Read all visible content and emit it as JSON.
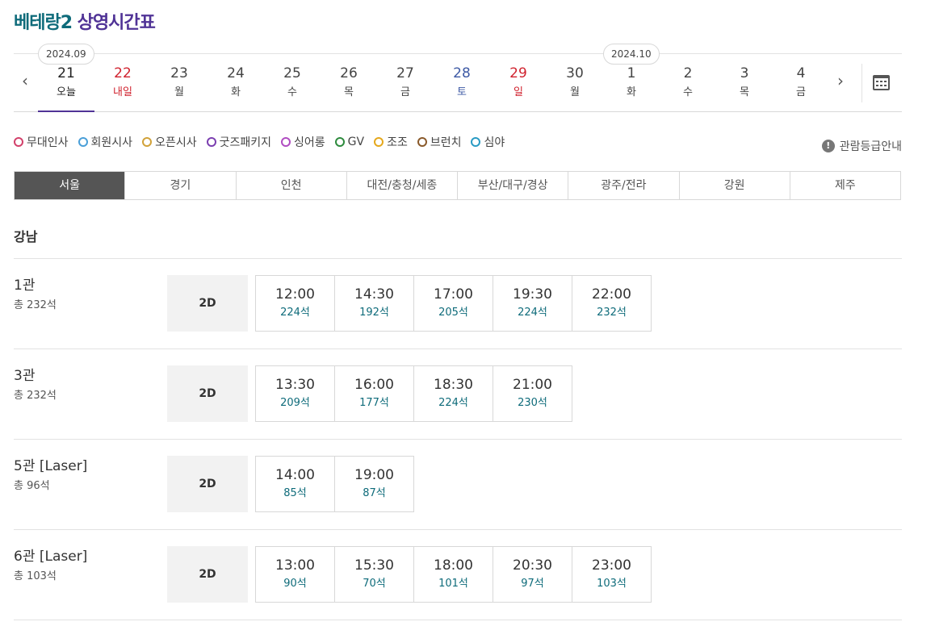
{
  "title": {
    "movie": "베테랑2",
    "suffix": "상영시간표"
  },
  "months": [
    "2024.09",
    "2024.10"
  ],
  "days": [
    {
      "num": "21",
      "dow": "오늘",
      "kind": "active"
    },
    {
      "num": "22",
      "dow": "내일",
      "kind": "hol"
    },
    {
      "num": "23",
      "dow": "월",
      "kind": ""
    },
    {
      "num": "24",
      "dow": "화",
      "kind": ""
    },
    {
      "num": "25",
      "dow": "수",
      "kind": ""
    },
    {
      "num": "26",
      "dow": "목",
      "kind": ""
    },
    {
      "num": "27",
      "dow": "금",
      "kind": ""
    },
    {
      "num": "28",
      "dow": "토",
      "kind": "sat"
    },
    {
      "num": "29",
      "dow": "일",
      "kind": "hol"
    },
    {
      "num": "30",
      "dow": "월",
      "kind": ""
    },
    {
      "num": "1",
      "dow": "화",
      "kind": ""
    },
    {
      "num": "2",
      "dow": "수",
      "kind": ""
    },
    {
      "num": "3",
      "dow": "목",
      "kind": ""
    },
    {
      "num": "4",
      "dow": "금",
      "kind": ""
    }
  ],
  "nav": {
    "prev": "‹",
    "next": "›"
  },
  "legend": [
    {
      "label": "무대인사",
      "color": "#d2416b",
      "icon": "stage-greeting-icon"
    },
    {
      "label": "회원시사",
      "color": "#4a9fd8",
      "icon": "member-preview-icon"
    },
    {
      "label": "오픈시사",
      "color": "#d1a23a",
      "icon": "open-preview-icon"
    },
    {
      "label": "굿즈패키지",
      "color": "#7b3fb0",
      "icon": "goods-package-icon"
    },
    {
      "label": "싱어롱",
      "color": "#b04dc2",
      "icon": "singalong-icon"
    },
    {
      "label": "GV",
      "color": "#2e8b3e",
      "icon": "gv-icon"
    },
    {
      "label": "조조",
      "color": "#e5a81c",
      "icon": "morning-icon"
    },
    {
      "label": "브런치",
      "color": "#8a5a2b",
      "icon": "brunch-icon"
    },
    {
      "label": "심야",
      "color": "#2a9bc4",
      "icon": "midnight-icon"
    }
  ],
  "guide_label": "관람등급안내",
  "regions": [
    "서울",
    "경기",
    "인천",
    "대전/충청/세종",
    "부산/대구/경상",
    "광주/전라",
    "강원",
    "제주"
  ],
  "theater": "강남",
  "screens": [
    {
      "name": "1관",
      "seats": "총 232석",
      "format": "2D",
      "times": [
        {
          "t": "12:00",
          "s": "224석"
        },
        {
          "t": "14:30",
          "s": "192석"
        },
        {
          "t": "17:00",
          "s": "205석"
        },
        {
          "t": "19:30",
          "s": "224석"
        },
        {
          "t": "22:00",
          "s": "232석"
        }
      ]
    },
    {
      "name": "3관",
      "seats": "총 232석",
      "format": "2D",
      "times": [
        {
          "t": "13:30",
          "s": "209석"
        },
        {
          "t": "16:00",
          "s": "177석"
        },
        {
          "t": "18:30",
          "s": "224석"
        },
        {
          "t": "21:00",
          "s": "230석"
        }
      ]
    },
    {
      "name": "5관 [Laser]",
      "seats": "총 96석",
      "format": "2D",
      "times": [
        {
          "t": "14:00",
          "s": "85석"
        },
        {
          "t": "19:00",
          "s": "87석"
        }
      ]
    },
    {
      "name": "6관 [Laser]",
      "seats": "총 103석",
      "format": "2D",
      "times": [
        {
          "t": "13:00",
          "s": "90석"
        },
        {
          "t": "15:30",
          "s": "70석"
        },
        {
          "t": "18:00",
          "s": "101석"
        },
        {
          "t": "20:30",
          "s": "97석"
        },
        {
          "t": "23:00",
          "s": "103석"
        }
      ]
    }
  ]
}
